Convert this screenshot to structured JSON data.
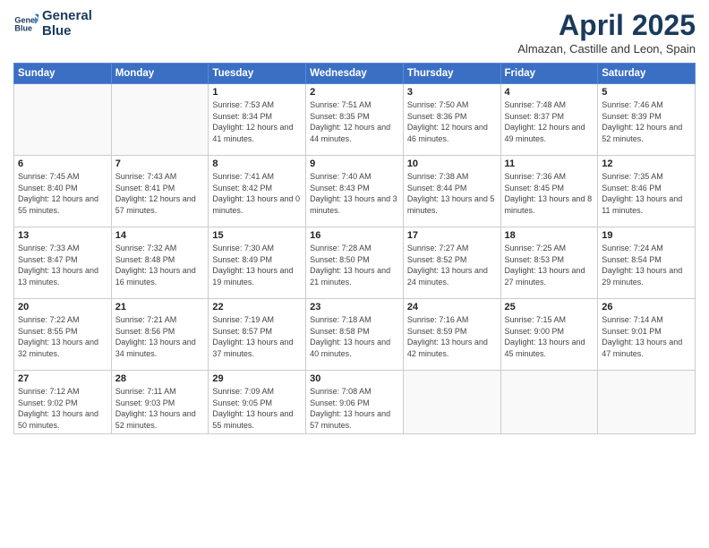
{
  "logo": {
    "line1": "General",
    "line2": "Blue"
  },
  "title": "April 2025",
  "subtitle": "Almazan, Castille and Leon, Spain",
  "weekdays": [
    "Sunday",
    "Monday",
    "Tuesday",
    "Wednesday",
    "Thursday",
    "Friday",
    "Saturday"
  ],
  "weeks": [
    [
      {
        "day": "",
        "sunrise": "",
        "sunset": "",
        "daylight": ""
      },
      {
        "day": "",
        "sunrise": "",
        "sunset": "",
        "daylight": ""
      },
      {
        "day": "1",
        "sunrise": "Sunrise: 7:53 AM",
        "sunset": "Sunset: 8:34 PM",
        "daylight": "Daylight: 12 hours and 41 minutes."
      },
      {
        "day": "2",
        "sunrise": "Sunrise: 7:51 AM",
        "sunset": "Sunset: 8:35 PM",
        "daylight": "Daylight: 12 hours and 44 minutes."
      },
      {
        "day": "3",
        "sunrise": "Sunrise: 7:50 AM",
        "sunset": "Sunset: 8:36 PM",
        "daylight": "Daylight: 12 hours and 46 minutes."
      },
      {
        "day": "4",
        "sunrise": "Sunrise: 7:48 AM",
        "sunset": "Sunset: 8:37 PM",
        "daylight": "Daylight: 12 hours and 49 minutes."
      },
      {
        "day": "5",
        "sunrise": "Sunrise: 7:46 AM",
        "sunset": "Sunset: 8:39 PM",
        "daylight": "Daylight: 12 hours and 52 minutes."
      }
    ],
    [
      {
        "day": "6",
        "sunrise": "Sunrise: 7:45 AM",
        "sunset": "Sunset: 8:40 PM",
        "daylight": "Daylight: 12 hours and 55 minutes."
      },
      {
        "day": "7",
        "sunrise": "Sunrise: 7:43 AM",
        "sunset": "Sunset: 8:41 PM",
        "daylight": "Daylight: 12 hours and 57 minutes."
      },
      {
        "day": "8",
        "sunrise": "Sunrise: 7:41 AM",
        "sunset": "Sunset: 8:42 PM",
        "daylight": "Daylight: 13 hours and 0 minutes."
      },
      {
        "day": "9",
        "sunrise": "Sunrise: 7:40 AM",
        "sunset": "Sunset: 8:43 PM",
        "daylight": "Daylight: 13 hours and 3 minutes."
      },
      {
        "day": "10",
        "sunrise": "Sunrise: 7:38 AM",
        "sunset": "Sunset: 8:44 PM",
        "daylight": "Daylight: 13 hours and 5 minutes."
      },
      {
        "day": "11",
        "sunrise": "Sunrise: 7:36 AM",
        "sunset": "Sunset: 8:45 PM",
        "daylight": "Daylight: 13 hours and 8 minutes."
      },
      {
        "day": "12",
        "sunrise": "Sunrise: 7:35 AM",
        "sunset": "Sunset: 8:46 PM",
        "daylight": "Daylight: 13 hours and 11 minutes."
      }
    ],
    [
      {
        "day": "13",
        "sunrise": "Sunrise: 7:33 AM",
        "sunset": "Sunset: 8:47 PM",
        "daylight": "Daylight: 13 hours and 13 minutes."
      },
      {
        "day": "14",
        "sunrise": "Sunrise: 7:32 AM",
        "sunset": "Sunset: 8:48 PM",
        "daylight": "Daylight: 13 hours and 16 minutes."
      },
      {
        "day": "15",
        "sunrise": "Sunrise: 7:30 AM",
        "sunset": "Sunset: 8:49 PM",
        "daylight": "Daylight: 13 hours and 19 minutes."
      },
      {
        "day": "16",
        "sunrise": "Sunrise: 7:28 AM",
        "sunset": "Sunset: 8:50 PM",
        "daylight": "Daylight: 13 hours and 21 minutes."
      },
      {
        "day": "17",
        "sunrise": "Sunrise: 7:27 AM",
        "sunset": "Sunset: 8:52 PM",
        "daylight": "Daylight: 13 hours and 24 minutes."
      },
      {
        "day": "18",
        "sunrise": "Sunrise: 7:25 AM",
        "sunset": "Sunset: 8:53 PM",
        "daylight": "Daylight: 13 hours and 27 minutes."
      },
      {
        "day": "19",
        "sunrise": "Sunrise: 7:24 AM",
        "sunset": "Sunset: 8:54 PM",
        "daylight": "Daylight: 13 hours and 29 minutes."
      }
    ],
    [
      {
        "day": "20",
        "sunrise": "Sunrise: 7:22 AM",
        "sunset": "Sunset: 8:55 PM",
        "daylight": "Daylight: 13 hours and 32 minutes."
      },
      {
        "day": "21",
        "sunrise": "Sunrise: 7:21 AM",
        "sunset": "Sunset: 8:56 PM",
        "daylight": "Daylight: 13 hours and 34 minutes."
      },
      {
        "day": "22",
        "sunrise": "Sunrise: 7:19 AM",
        "sunset": "Sunset: 8:57 PM",
        "daylight": "Daylight: 13 hours and 37 minutes."
      },
      {
        "day": "23",
        "sunrise": "Sunrise: 7:18 AM",
        "sunset": "Sunset: 8:58 PM",
        "daylight": "Daylight: 13 hours and 40 minutes."
      },
      {
        "day": "24",
        "sunrise": "Sunrise: 7:16 AM",
        "sunset": "Sunset: 8:59 PM",
        "daylight": "Daylight: 13 hours and 42 minutes."
      },
      {
        "day": "25",
        "sunrise": "Sunrise: 7:15 AM",
        "sunset": "Sunset: 9:00 PM",
        "daylight": "Daylight: 13 hours and 45 minutes."
      },
      {
        "day": "26",
        "sunrise": "Sunrise: 7:14 AM",
        "sunset": "Sunset: 9:01 PM",
        "daylight": "Daylight: 13 hours and 47 minutes."
      }
    ],
    [
      {
        "day": "27",
        "sunrise": "Sunrise: 7:12 AM",
        "sunset": "Sunset: 9:02 PM",
        "daylight": "Daylight: 13 hours and 50 minutes."
      },
      {
        "day": "28",
        "sunrise": "Sunrise: 7:11 AM",
        "sunset": "Sunset: 9:03 PM",
        "daylight": "Daylight: 13 hours and 52 minutes."
      },
      {
        "day": "29",
        "sunrise": "Sunrise: 7:09 AM",
        "sunset": "Sunset: 9:05 PM",
        "daylight": "Daylight: 13 hours and 55 minutes."
      },
      {
        "day": "30",
        "sunrise": "Sunrise: 7:08 AM",
        "sunset": "Sunset: 9:06 PM",
        "daylight": "Daylight: 13 hours and 57 minutes."
      },
      {
        "day": "",
        "sunrise": "",
        "sunset": "",
        "daylight": ""
      },
      {
        "day": "",
        "sunrise": "",
        "sunset": "",
        "daylight": ""
      },
      {
        "day": "",
        "sunrise": "",
        "sunset": "",
        "daylight": ""
      }
    ]
  ]
}
